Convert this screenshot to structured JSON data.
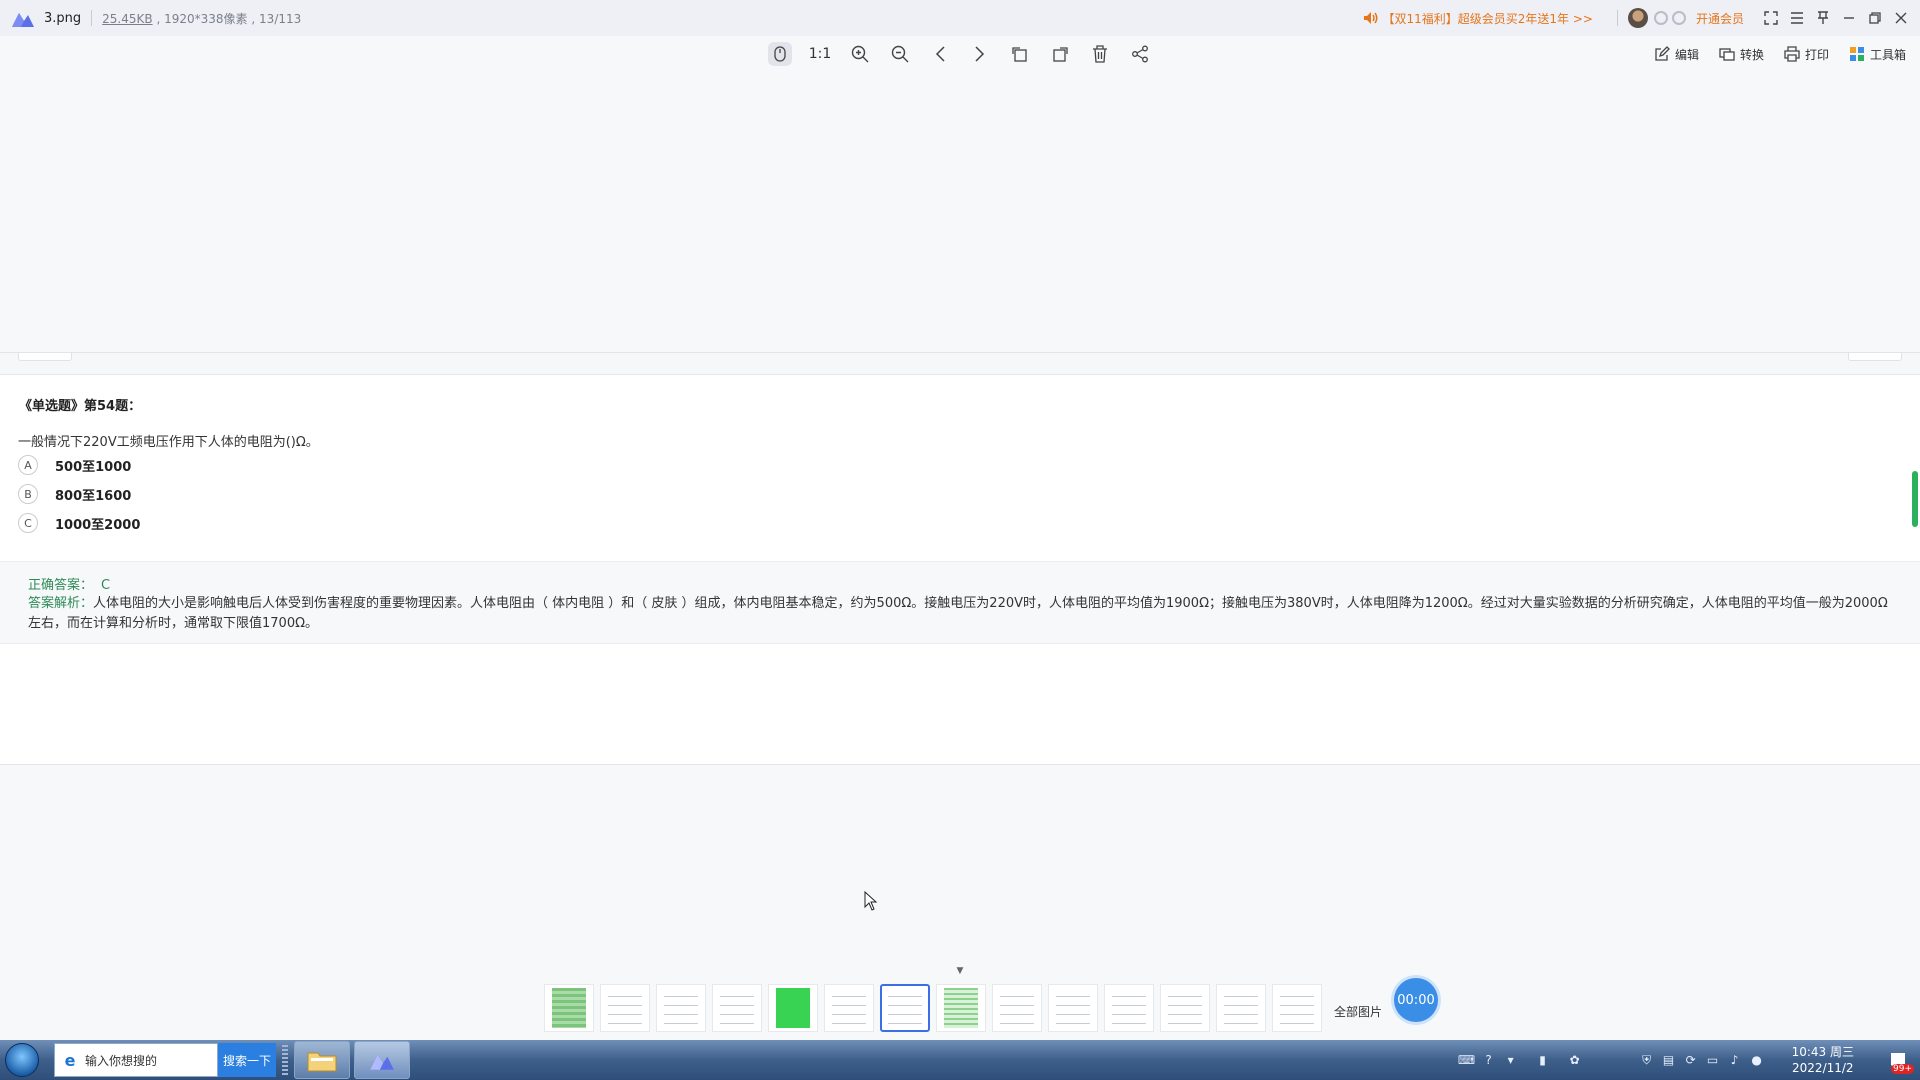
{
  "titlebar": {
    "file_name": "3.png",
    "file_size": "25.45KB",
    "dimensions": "1920*338像素",
    "position": "13/113",
    "promo": "【双11福利】超级会员买2年送1年 >>",
    "vip_label": "开通会员"
  },
  "toolbar": {
    "ratio_label": "1:1",
    "edit_label": "编辑",
    "convert_label": "转换",
    "print_label": "打印",
    "toolbox_label": "工具箱"
  },
  "question": {
    "title": "《单选题》第54题：",
    "text": "一般情况下220V工频电压作用下人体的电阻为()Ω。",
    "options": [
      {
        "letter": "A",
        "text": "500至1000"
      },
      {
        "letter": "B",
        "text": "800至1600"
      },
      {
        "letter": "C",
        "text": "1000至2000"
      }
    ],
    "answer_label": "正确答案：",
    "answer_value": "C",
    "analysis_label": "答案解析：",
    "analysis_text": "人体电阻的大小是影响触电后人体受到伤害程度的重要物理因素。人体电阻由（ 体内电阻 ）和（ 皮肤 ）组成，体内电阻基本稳定，约为500Ω。接触电压为220V时，人体电阻的平均值为1900Ω；接触电压为380V时，人体电阻降为1200Ω。经过对大量实验数据的分析研究确定，人体电阻的平均值一般为2000Ω左右，而在计算和分析时，通常取下限值1700Ω。"
  },
  "thumbnails": {
    "all_images_label": "全部图片",
    "timer": "00:00"
  },
  "taskbar": {
    "search_placeholder": "输入你想搜的",
    "search_button": "搜索一下",
    "time": "10:43 周三",
    "date": "2022/11/2",
    "notify_badge": "99+"
  }
}
